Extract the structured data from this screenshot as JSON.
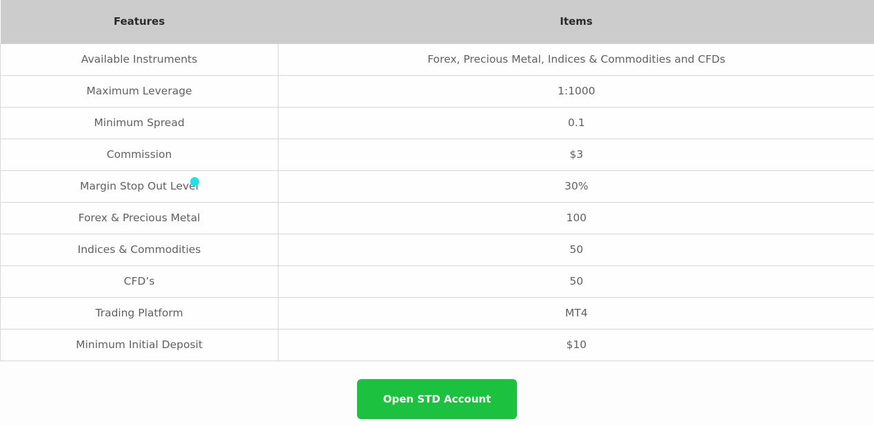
{
  "table": {
    "headers": {
      "features": "Features",
      "items": "Items"
    },
    "rows": [
      {
        "feature": "Available Instruments",
        "item": "Forex, Precious Metal, Indices & Commodities and CFDs"
      },
      {
        "feature": "Maximum Leverage",
        "item": "1:1000"
      },
      {
        "feature": "Minimum Spread",
        "item": "0.1"
      },
      {
        "feature": "Commission",
        "item": "$3"
      },
      {
        "feature": "Margin Stop Out Level",
        "item": "30%"
      },
      {
        "feature": "Forex & Precious Metal",
        "item": "100"
      },
      {
        "feature": "Indices & Commodities",
        "item": "50"
      },
      {
        "feature": "CFD’s",
        "item": "50"
      },
      {
        "feature": "Trading Platform",
        "item": "MT4"
      },
      {
        "feature": "Minimum Initial Deposit",
        "item": "$10"
      }
    ]
  },
  "cta": {
    "label": "Open STD Account",
    "color": "#1bc13f"
  },
  "colors": {
    "header_bg": "#cccccc",
    "cursor": "#1fe0e8"
  }
}
